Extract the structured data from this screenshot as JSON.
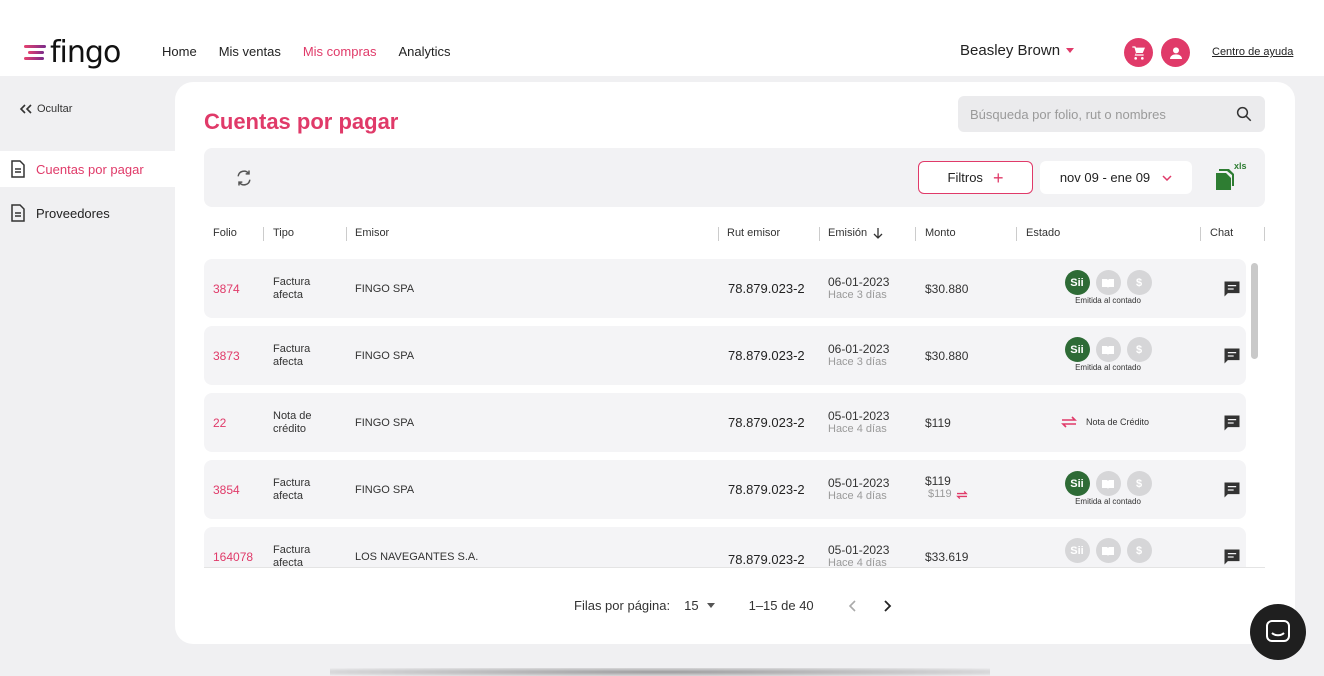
{
  "header": {
    "logo_text": "fingo",
    "nav": [
      "Home",
      "Mis ventas",
      "Mis compras",
      "Analytics"
    ],
    "active_nav_index": 2,
    "user_name": "Beasley Brown",
    "help_link": "Centro de ayuda",
    "icons": [
      "cart-icon",
      "user-icon"
    ]
  },
  "sidebar": {
    "hide_label": "Ocultar",
    "items": [
      {
        "label": "Cuentas por pagar",
        "icon": "document-icon",
        "active": true
      },
      {
        "label": "Proveedores",
        "icon": "document-icon",
        "active": false
      }
    ]
  },
  "main": {
    "title": "Cuentas por pagar",
    "search_placeholder": "Búsqueda por folio, rut o nombres",
    "filters_label": "Filtros",
    "date_range": "nov 09 - ene 09",
    "export_label": "xls"
  },
  "table": {
    "columns": [
      "Folio",
      "Tipo",
      "Emisor",
      "Rut emisor",
      "Emisión",
      "Monto",
      "Estado",
      "Chat"
    ],
    "sorted_column": "Emisión",
    "rows": [
      {
        "folio": "3874",
        "tipo1": "Factura",
        "tipo2": "afecta",
        "emisor": "FINGO SPA",
        "rut": "78.879.023-2",
        "fecha": "06-01-2023",
        "hace": "Hace 3 días",
        "monto": "$30.880",
        "monto2": "",
        "estado": "Emitida al contado",
        "estado_type": "sii"
      },
      {
        "folio": "3873",
        "tipo1": "Factura",
        "tipo2": "afecta",
        "emisor": "FINGO SPA",
        "rut": "78.879.023-2",
        "fecha": "06-01-2023",
        "hace": "Hace 3 días",
        "monto": "$30.880",
        "monto2": "",
        "estado": "Emitida al contado",
        "estado_type": "sii"
      },
      {
        "folio": "22",
        "tipo1": "Nota de",
        "tipo2": "crédito",
        "emisor": "FINGO SPA",
        "rut": "78.879.023-2",
        "fecha": "05-01-2023",
        "hace": "Hace 4 días",
        "monto": "$119",
        "monto2": "",
        "estado": "Nota de Crédito",
        "estado_type": "nc"
      },
      {
        "folio": "3854",
        "tipo1": "Factura",
        "tipo2": "afecta",
        "emisor": "FINGO SPA",
        "rut": "78.879.023-2",
        "fecha": "05-01-2023",
        "hace": "Hace 4 días",
        "monto": "$119",
        "monto2": "$119",
        "estado": "Emitida al contado",
        "estado_type": "sii"
      },
      {
        "folio": "164078",
        "tipo1": "Factura",
        "tipo2": "afecta",
        "emisor": "LOS NAVEGANTES S.A.",
        "rut": "78.879.023-2",
        "fecha": "05-01-2023",
        "hace": "Hace 4 días",
        "monto": "$33.619",
        "monto2": "",
        "estado": "",
        "estado_type": "grey"
      }
    ]
  },
  "pagination": {
    "rows_label": "Filas por página:",
    "rows_value": "15",
    "range": "1–15 de 40"
  },
  "colors": {
    "accent": "#e03a69",
    "sii_green": "#2e6b36"
  }
}
